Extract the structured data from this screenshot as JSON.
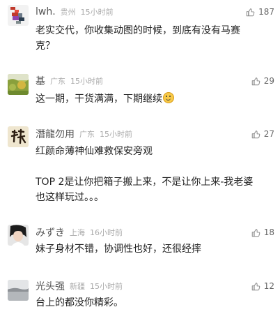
{
  "comments": [
    {
      "name": "lwh.",
      "location": "贵州",
      "time": "15小时前",
      "likes": "187",
      "lines": [
        "老实交代，你收集动图的时候，到底有没有马赛",
        "克？"
      ],
      "avatar_icon": "pixel-art-avatar"
    },
    {
      "name": "基",
      "location": "广东",
      "time": "15小时前",
      "likes": "29",
      "lines": [
        "这一期，干货满满，下期继续"
      ],
      "emoji": "smile-emoji",
      "avatar_icon": "landscape-photo-avatar"
    },
    {
      "name": "潛龍勿用",
      "location": "广东",
      "time": "15小时前",
      "likes": "27",
      "lines": [
        "红颜命薄神仙难救保安旁观",
        "",
        "TOP 2是让你把箱子搬上来，不是让你上来-我老婆",
        "也这样玩过。。。"
      ],
      "avatar_icon": "calligraphy-avatar"
    },
    {
      "name": "みずき",
      "location": "上海",
      "time": "16小时前",
      "likes": "18",
      "lines": [
        "妹子身材不错，协调性也好，还很经摔"
      ],
      "avatar_icon": "portrait-avatar"
    },
    {
      "name": "光头强",
      "location": "新疆",
      "time": "15小时前",
      "likes": "12",
      "lines": [
        "台上的都没你精彩。"
      ],
      "avatar_icon": "gray-landscape-avatar"
    }
  ],
  "colors": {
    "name": "#555555",
    "meta": "#aaaaaa",
    "text": "#222222",
    "like_icon": "#888888"
  }
}
